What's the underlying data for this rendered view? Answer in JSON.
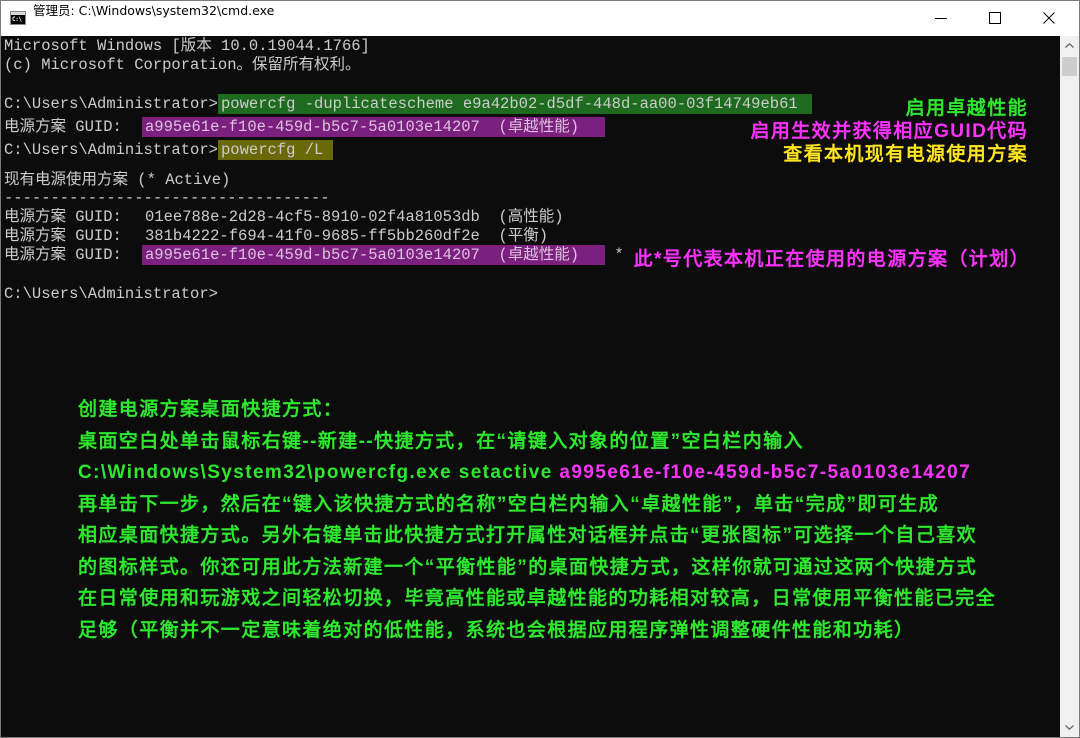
{
  "window": {
    "title": "管理员: C:\\Windows\\system32\\cmd.exe",
    "app_icon_text": "C:\\"
  },
  "icons": {
    "app": "cmd-icon",
    "minimize": "minimize-icon",
    "maximize": "maximize-icon",
    "close": "close-icon",
    "scroll_up": "chevron-up-icon",
    "scroll_down": "chevron-down-icon"
  },
  "console": {
    "banner": [
      "Microsoft Windows [版本 10.0.19044.1766]",
      "(c) Microsoft Corporation。保留所有权利。"
    ],
    "prompt": "C:\\Users\\Administrator>",
    "command_duplicate": "powercfg -duplicatescheme e9a42b02-d5df-448d-aa00-03f14749eb61",
    "duplicate_output": {
      "label": "电源方案 GUID:",
      "value": "a995e61e-f10e-459d-b5c7-5a0103e14207  (卓越性能)"
    },
    "command_list": "powercfg /L",
    "list_title": "现有电源使用方案 (* Active)",
    "separator": "-----------------------------------",
    "schemes": [
      {
        "label": "电源方案 GUID:",
        "value": "01ee788e-2d28-4cf5-8910-02f4a81053db  (高性能)"
      },
      {
        "label": "电源方案 GUID:",
        "value": "381b4222-f694-41f0-9685-ff5bb260df2e  (平衡)"
      },
      {
        "label": "电源方案 GUID:",
        "value": "a995e61e-f10e-459d-b5c7-5a0103e14207  (卓越性能)",
        "active_mark": "*"
      }
    ]
  },
  "annotations": {
    "enable_ultimate": "启用卓越性能",
    "get_guid": "启用生效并获得相应GUID代码",
    "list_schemes": "查看本机现有电源使用方案",
    "active_mark_note": "此*号代表本机正在使用的电源方案（计划）"
  },
  "note": {
    "heading": "创建电源方案桌面快捷方式：",
    "intro": "桌面空白处单击鼠标右键--新建--快捷方式，在“请键入对象的位置”空白栏内输入",
    "command": "C:\\Windows\\System32\\powercfg.exe setactive",
    "command_guid": "a995e61e-f10e-459d-b5c7-5a0103e14207",
    "body": [
      "再单击下一步，然后在“键入该快捷方式的名称”空白栏内输入“卓越性能”，单击“完成”即可生成",
      "相应桌面快捷方式。另外右键单击此快捷方式打开属性对话框并点击“更张图标”可选择一个自己喜欢",
      "的图标样式。你还可用此方法新建一个“平衡性能”的桌面快捷方式，这样你就可通过这两个快捷方式",
      "在日常使用和玩游戏之间轻松切换，毕竟高性能或卓越性能的功耗相对较高，日常使用平衡性能已完全",
      "足够（平衡并不一定意味着绝对的低性能，系统也会根据应用程序弹性调整硬件性能和功耗）"
    ]
  },
  "colors": {
    "console_bg": "#0c0c0c",
    "console_text": "#cccccc",
    "highlight_green": "#1e6a1e",
    "highlight_purple": "#7b207f",
    "highlight_olive": "#6a690a",
    "annotation_green": "#2ee82e",
    "annotation_magenta": "#ff33ff",
    "annotation_yellow": "#ffe51f"
  }
}
